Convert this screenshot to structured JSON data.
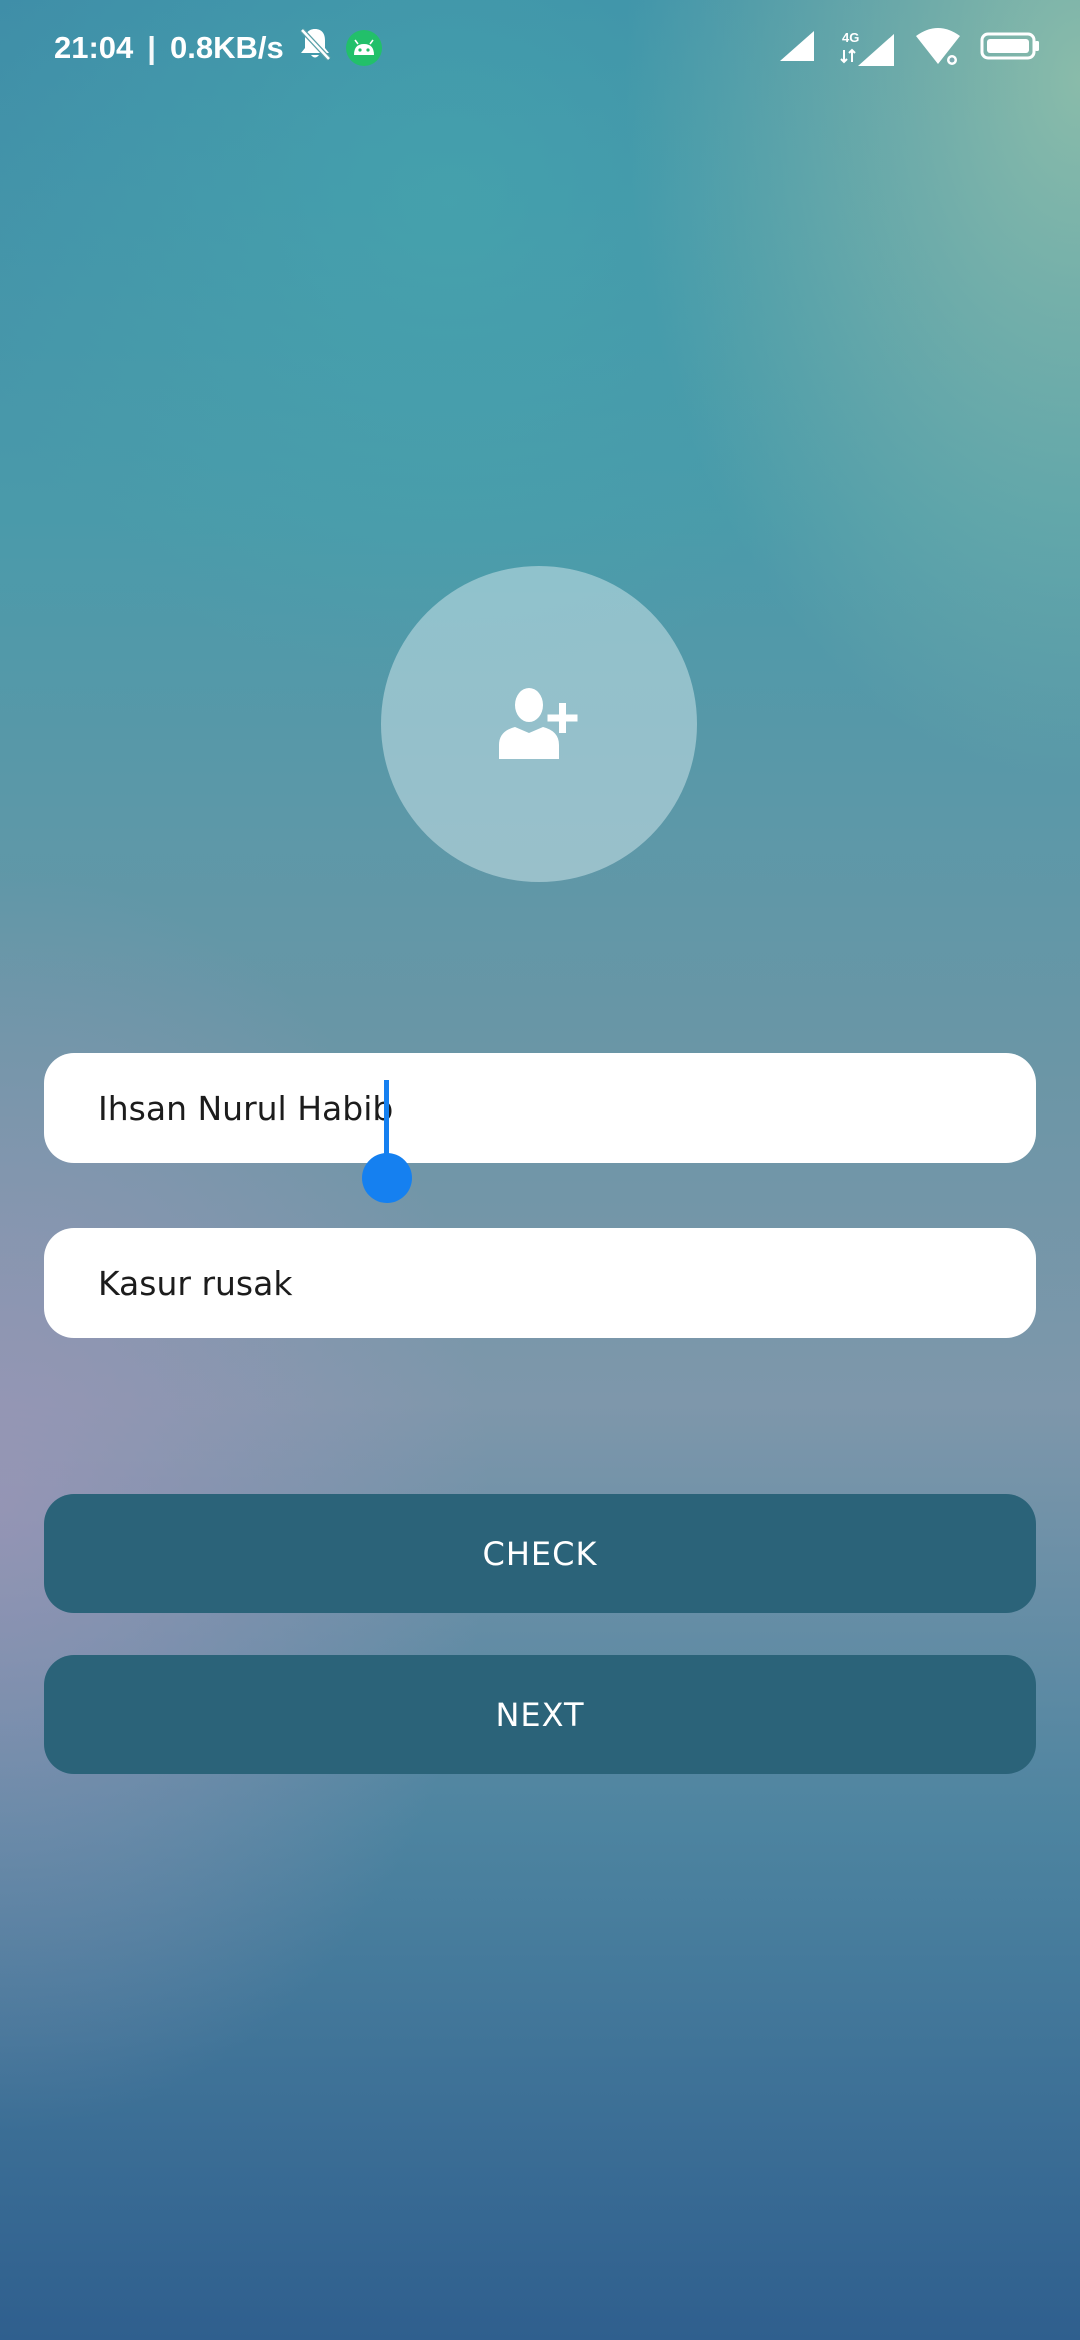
{
  "status_bar": {
    "time": "21:04",
    "separator": "|",
    "network_speed": "0.8KB/s",
    "icons": [
      "bell-muted-icon",
      "android-icon",
      "signal-icon",
      "signal-4g-icon",
      "wifi-icon",
      "battery-icon"
    ],
    "network_type": "4G"
  },
  "avatar": {
    "icon": "add-user-icon"
  },
  "form": {
    "name_value": "Ihsan Nurul Habib",
    "reason_value": "Kasur rusak"
  },
  "buttons": {
    "check_label": "CHECK",
    "next_label": "NEXT"
  },
  "colors": {
    "button_bg": "#2b6379",
    "caret": "#1580f0",
    "field_bg": "#ffffff"
  }
}
